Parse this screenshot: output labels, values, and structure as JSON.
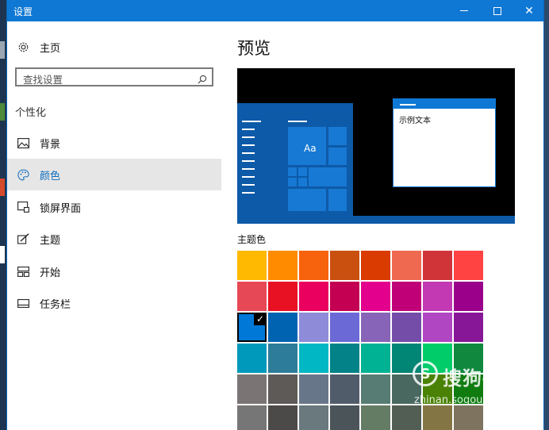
{
  "window": {
    "title": "设置",
    "minimize_symbol": "—",
    "maximize_symbol": "□",
    "close_symbol": "✕"
  },
  "sidebar": {
    "home": {
      "label": "主页",
      "icon": "gear-icon"
    },
    "search": {
      "placeholder": "查找设置",
      "icon": "search-icon"
    },
    "section_label": "个性化",
    "items": [
      {
        "label": "背景",
        "icon": "image-icon",
        "active": false
      },
      {
        "label": "颜色",
        "icon": "palette-icon",
        "active": true
      },
      {
        "label": "锁屏界面",
        "icon": "lock-screen-icon",
        "active": false
      },
      {
        "label": "主题",
        "icon": "theme-brush-icon",
        "active": false
      },
      {
        "label": "开始",
        "icon": "start-icon",
        "active": false
      },
      {
        "label": "任务栏",
        "icon": "taskbar-icon",
        "active": false
      }
    ]
  },
  "main": {
    "heading": "预览",
    "preview": {
      "tile_text": "Aa",
      "sample_text": "示例文本"
    },
    "accent_label": "主题色",
    "accent_colors": [
      [
        "#FFB900",
        "#FF8C00",
        "#F7630C",
        "#CA5010",
        "#DA3B01",
        "#EF6950",
        "#D13438",
        "#FF4343"
      ],
      [
        "#E74856",
        "#E81123",
        "#EA005E",
        "#C30052",
        "#E3008C",
        "#BF0077",
        "#C239B3",
        "#9A0089"
      ],
      [
        "#0078D7",
        "#0063B1",
        "#8E8CD8",
        "#6B69D6",
        "#8764B8",
        "#744DA9",
        "#B146C2",
        "#881798"
      ],
      [
        "#0099BC",
        "#2D7D9A",
        "#00B7C3",
        "#038387",
        "#00B294",
        "#018574",
        "#00CC6A",
        "#10893E"
      ],
      [
        "#7A7574",
        "#5D5A58",
        "#68768A",
        "#515C6B",
        "#567C73",
        "#486860",
        "#498205",
        "#107C10"
      ],
      [
        "#767676",
        "#4C4A48",
        "#69797E",
        "#4A5459",
        "#647C64",
        "#525E54",
        "#847545",
        "#7E735F"
      ]
    ],
    "selected_color": "#0078D7"
  },
  "watermark": {
    "logo": "S",
    "text": "搜狗指南",
    "url": "zhinan.sogou.com"
  }
}
